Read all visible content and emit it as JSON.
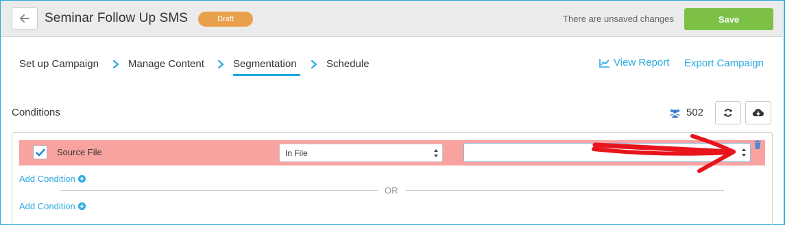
{
  "header": {
    "title": "Seminar Follow Up SMS",
    "status_badge": "Draft",
    "unsaved_text": "There are unsaved changes",
    "save_label": "Save"
  },
  "steps": [
    {
      "label": "Set up Campaign",
      "active": false
    },
    {
      "label": "Manage Content",
      "active": false
    },
    {
      "label": "Segmentation",
      "active": true
    },
    {
      "label": "Schedule",
      "active": false
    }
  ],
  "links": {
    "view_report": "View Report",
    "export_campaign": "Export Campaign"
  },
  "conditions": {
    "title": "Conditions",
    "count": "502",
    "rows": [
      {
        "checked": true,
        "field": "Source File",
        "operator": "In File",
        "value": ""
      }
    ],
    "add_condition_label": "Add Condition",
    "or_label": "OR"
  },
  "colors": {
    "accent": "#29a8e0",
    "save": "#7cc146",
    "draft": "#e9a04b",
    "error_row": "#f9a3a0",
    "annotation": "#e8141b"
  },
  "icons": [
    "back-arrow-icon",
    "chevron-right-icon",
    "line-chart-icon",
    "users-icon",
    "refresh-icon",
    "cloud-download-icon",
    "check-icon",
    "select-arrows-icon",
    "trash-icon",
    "plus-circle-icon"
  ]
}
